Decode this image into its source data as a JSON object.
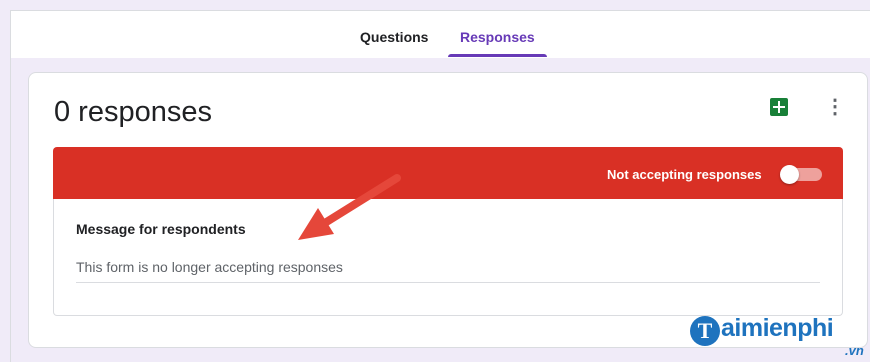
{
  "tabs": [
    {
      "label": "Questions",
      "active": false
    },
    {
      "label": "Responses",
      "active": true
    }
  ],
  "colors": {
    "accent": "#673ab7",
    "banner": "#d93025",
    "sheets": "#188038",
    "background": "#f0ebf8",
    "watermark": "#1e73be"
  },
  "summary": {
    "title": "0 responses",
    "sheets_icon": "google-sheets-icon",
    "more_icon": "more-vert-icon"
  },
  "banner": {
    "label": "Not accepting responses",
    "toggle_on": false
  },
  "message": {
    "label": "Message for respondents",
    "value": "This form is no longer accepting responses"
  },
  "watermark": {
    "logo_letter": "T",
    "text": "aimienphi",
    "suffix": ".vn"
  }
}
